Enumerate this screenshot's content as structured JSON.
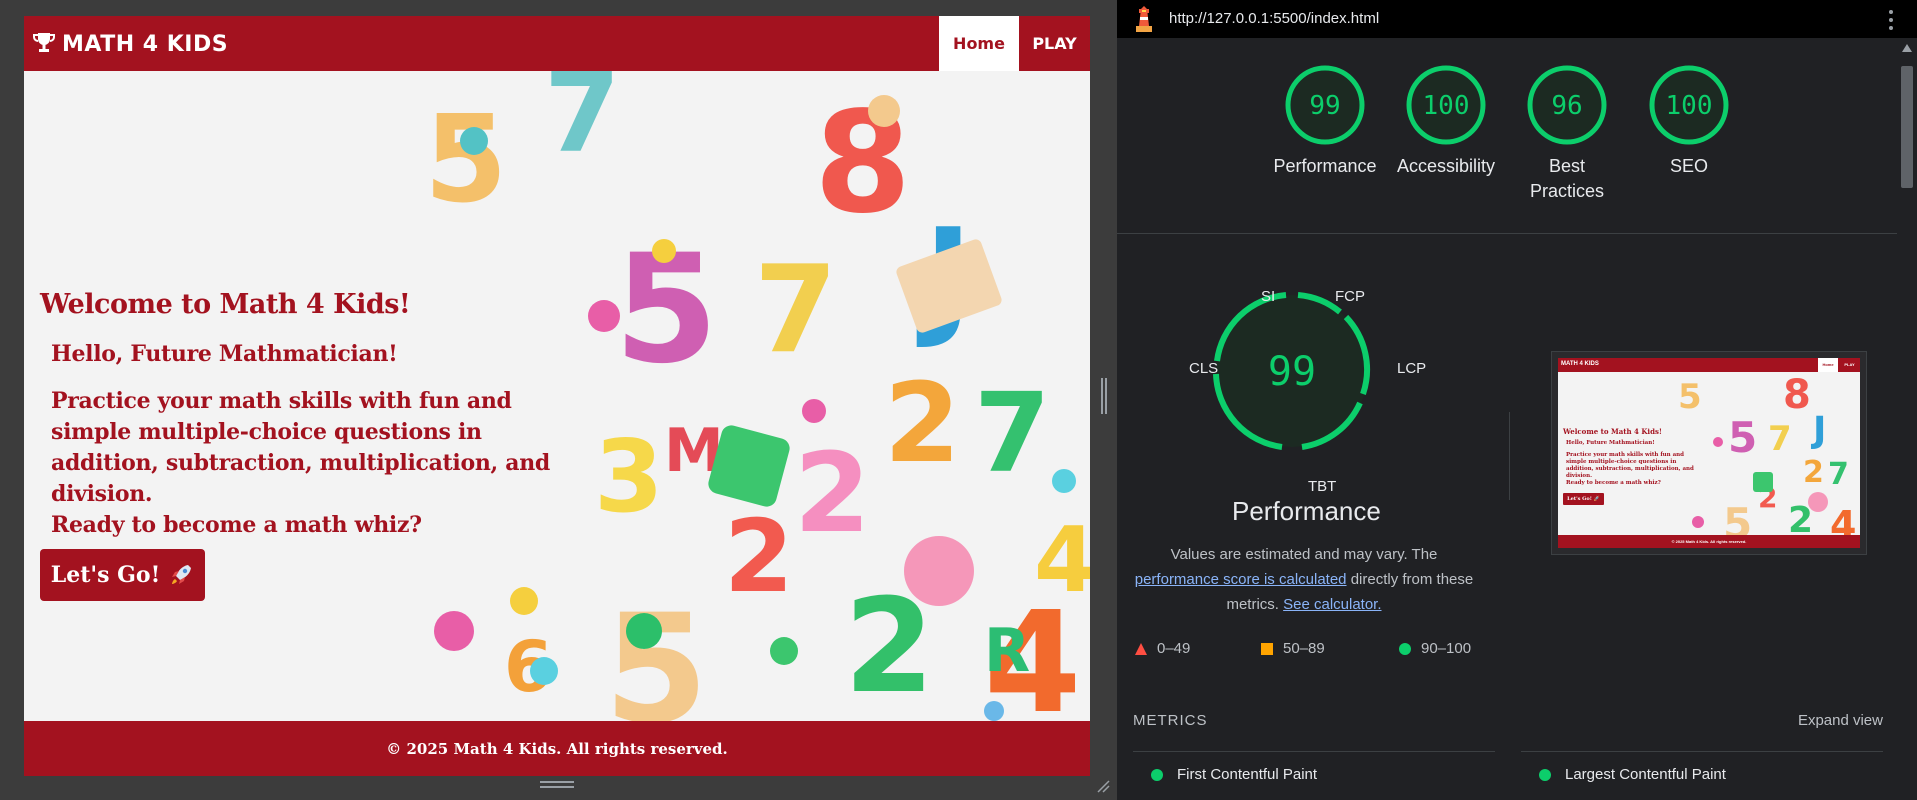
{
  "site": {
    "brand": "MATH 4 KIDS",
    "nav": {
      "home": "Home",
      "play": "PLAY"
    },
    "hero": {
      "title": "Welcome to Math 4 Kids!",
      "subtitle": "Hello, Future Mathmatician!",
      "description": "Practice your math skills with fun and simple multiple-choice questions in addition, subtraction, multiplication, and division.",
      "ready": "Ready to become a math whiz?",
      "cta": "Let's Go!"
    },
    "footer": "© 2025 Math 4 Kids. All rights reserved.",
    "icons": {
      "brand": "trophy-icon",
      "cta": "rocket-icon"
    },
    "colors": {
      "primary": "#a3121f",
      "hero_bg": "#f3f3f3"
    }
  },
  "lighthouse": {
    "url": "http://127.0.0.1:5500/index.html",
    "scores": [
      {
        "label": "Performance",
        "value": "99"
      },
      {
        "label": "Accessibility",
        "value": "100"
      },
      {
        "label": "Best Practices",
        "value": "96"
      },
      {
        "label": "SEO",
        "value": "100"
      }
    ],
    "performance": {
      "title": "Performance",
      "score": "99",
      "tags": {
        "si": "SI",
        "fcp": "FCP",
        "lcp": "LCP",
        "tbt": "TBT",
        "cls": "CLS"
      },
      "note_pre": "Values are estimated and may vary. The",
      "note_link": "performance score is calculated",
      "note_mid": "directly from these metrics.",
      "note_calc": "See calculator."
    },
    "legend": [
      {
        "range": "0–49",
        "shape": "triangle",
        "color": "#ff4e42"
      },
      {
        "range": "50–89",
        "shape": "square",
        "color": "#ffa400"
      },
      {
        "range": "90–100",
        "shape": "circle",
        "color": "#0cce6b"
      }
    ],
    "thumbnail": {
      "brand": "MATH 4 KIDS",
      "home": "Home",
      "play": "PLAY",
      "title": "Welcome to Math 4 Kids!",
      "subtitle": "Hello, Future Mathmatician!",
      "description": "Practice your math skills with fun and simple multiple-choice questions in addition, subtraction, multiplication, and division.",
      "ready": "Ready to become a math whiz?",
      "cta": "Let's Go! 🚀",
      "footer": "© 2025 Math 4 Kids. All rights reserved."
    },
    "metrics_heading": "METRICS",
    "expand_view": "Expand view",
    "metrics": [
      {
        "name": "First Contentful Paint"
      },
      {
        "name": "Largest Contentful Paint"
      }
    ],
    "colors": {
      "pass": "#0cce6b",
      "pass_bg": "#163a27",
      "link": "#8ab4f8"
    }
  }
}
